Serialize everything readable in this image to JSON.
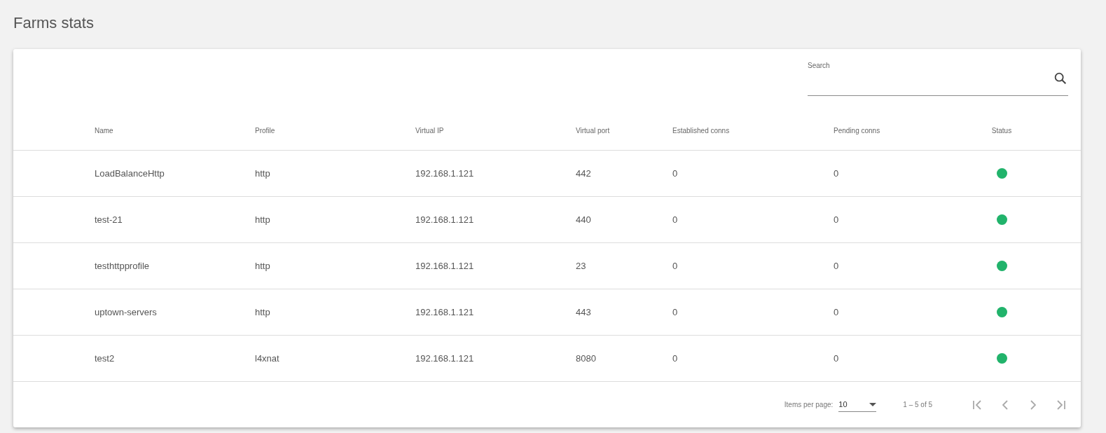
{
  "page_title": "Farms stats",
  "search": {
    "label": "Search"
  },
  "table": {
    "columns": [
      "Name",
      "Profile",
      "Virtual IP",
      "Virtual port",
      "Established conns",
      "Pending conns",
      "Status"
    ],
    "rows": [
      {
        "name": "LoadBalanceHttp",
        "profile": "http",
        "virtual_ip": "192.168.1.121",
        "virtual_port": "442",
        "established": "0",
        "pending": "0",
        "color": "#21b36b"
      },
      {
        "name": "test-21",
        "profile": "http",
        "virtual_ip": "192.168.1.121",
        "virtual_port": "440",
        "established": "0",
        "pending": "0",
        "color": "#21b36b"
      },
      {
        "name": "testhttpprofile",
        "profile": "http",
        "virtual_ip": "192.168.1.121",
        "virtual_port": "23",
        "established": "0",
        "pending": "0",
        "color": "#21b36b"
      },
      {
        "name": "uptown-servers",
        "profile": "http",
        "virtual_ip": "192.168.1.121",
        "virtual_port": "443",
        "established": "0",
        "pending": "0",
        "color": "#21b36b"
      },
      {
        "name": "test2",
        "profile": "l4xnat",
        "virtual_ip": "192.168.1.121",
        "virtual_port": "8080",
        "established": "0",
        "pending": "0",
        "color": "#21b36b"
      }
    ]
  },
  "paginator": {
    "items_per_page_label": "Items per page:",
    "page_size": "10",
    "range": "1 – 5 of 5",
    "buttons": [
      {
        "kind": "first",
        "disabled": true
      },
      {
        "kind": "previous",
        "disabled": true
      },
      {
        "kind": "next",
        "disabled": true
      },
      {
        "kind": "last",
        "disabled": true
      }
    ]
  }
}
